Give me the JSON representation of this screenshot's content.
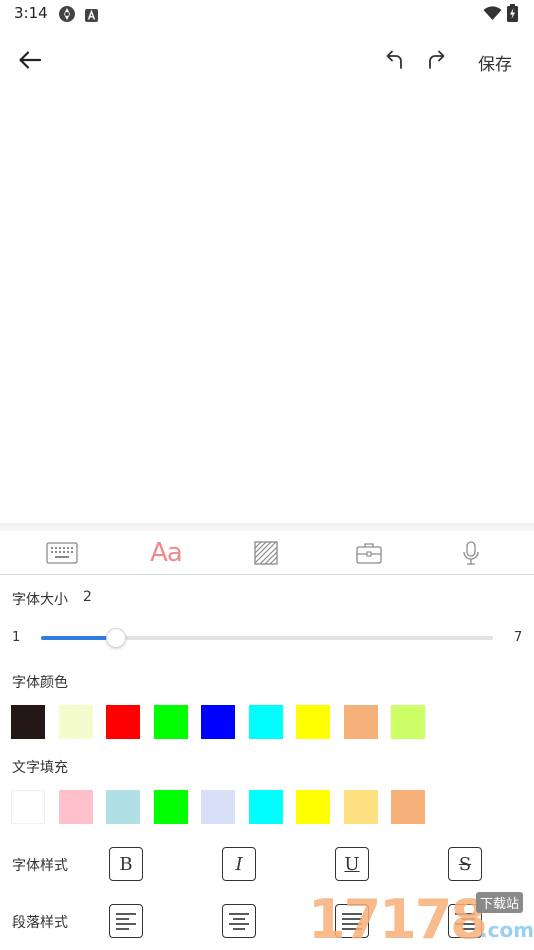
{
  "status_bar": {
    "time": "3:14",
    "icons": [
      "location-app-icon",
      "a-app-icon",
      "wifi-icon",
      "battery-charging-icon"
    ]
  },
  "toolbar": {
    "back_icon": "arrow-left-icon",
    "undo_icon": "undo-icon",
    "redo_icon": "redo-icon",
    "save_label": "保存"
  },
  "tabs": {
    "items": [
      "keyboard-icon",
      "font-style-tab",
      "texture-icon",
      "briefcase-icon",
      "microphone-icon"
    ],
    "font_tab_label": "Aa",
    "active_color": "#f08a8a"
  },
  "font_size": {
    "label": "字体大小",
    "value": "2",
    "min_label": "1",
    "max_label": "7",
    "min": 1,
    "max": 7,
    "current": 2,
    "accent_color": "#2f7de1"
  },
  "font_color": {
    "label": "字体颜色",
    "swatches": [
      "#231815",
      "#f4fbcd",
      "#ff0000",
      "#00ff00",
      "#0000ff",
      "#00ffff",
      "#ffff00",
      "#f6b07a",
      "#ccff66"
    ]
  },
  "text_fill": {
    "label": "文字填充",
    "swatches": [
      "#ffffff",
      "#ffc0cb",
      "#b0e0e6",
      "#00ff00",
      "#d8e0f8",
      "#00ffff",
      "#ffff00",
      "#ffe080",
      "#f6b07a"
    ]
  },
  "font_style": {
    "label": "字体样式",
    "buttons": [
      "B",
      "I",
      "U",
      "S"
    ]
  },
  "paragraph_style": {
    "label": "段落样式",
    "icons": [
      "align-left-icon",
      "align-center-icon",
      "align-justify-icon",
      "align-right-icon"
    ]
  },
  "watermark": {
    "number": "17178",
    "badge": "下载站",
    "suffix": ".com"
  }
}
